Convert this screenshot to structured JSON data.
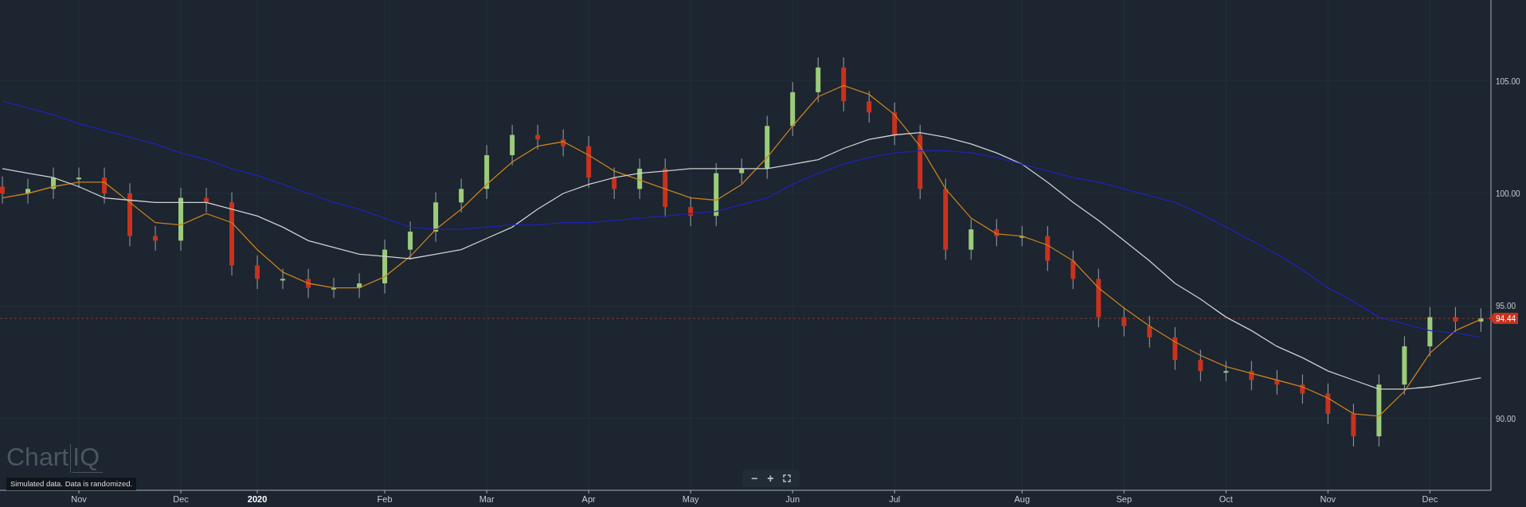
{
  "chart": {
    "chart_data": {
      "type": "candlestick",
      "categories": [
        null,
        null,
        null,
        "Nov",
        null,
        null,
        null,
        "Dec",
        null,
        null,
        "2020",
        null,
        null,
        null,
        null,
        "Feb",
        null,
        null,
        null,
        "Mar",
        null,
        null,
        null,
        "Apr",
        null,
        null,
        null,
        "May",
        null,
        null,
        null,
        "Jun",
        null,
        null,
        null,
        "Jul",
        null,
        null,
        null,
        null,
        "Aug",
        null,
        null,
        null,
        "Sep",
        null,
        null,
        null,
        "Oct",
        null,
        null,
        null,
        "Nov",
        null,
        null,
        null,
        "Dec",
        null,
        null
      ],
      "ohlc": [
        [
          100.3,
          100.75,
          99.55,
          100.0
        ],
        [
          100.0,
          100.65,
          99.55,
          100.2
        ],
        [
          100.2,
          101.15,
          99.75,
          100.7
        ],
        [
          100.7,
          101.15,
          100.25,
          100.7
        ],
        [
          100.7,
          101.15,
          99.55,
          100.0
        ],
        [
          100.0,
          100.45,
          97.65,
          98.1
        ],
        [
          98.1,
          98.55,
          97.45,
          97.9
        ],
        [
          97.9,
          100.25,
          97.45,
          99.8
        ],
        [
          99.8,
          100.25,
          99.15,
          99.6
        ],
        [
          99.6,
          100.05,
          96.35,
          96.8
        ],
        [
          96.8,
          97.25,
          95.75,
          96.2
        ],
        [
          96.2,
          96.65,
          95.75,
          96.2
        ],
        [
          96.2,
          96.65,
          95.35,
          95.8
        ],
        [
          95.8,
          96.25,
          95.35,
          95.8
        ],
        [
          95.8,
          96.45,
          95.35,
          96.0
        ],
        [
          96.0,
          97.95,
          95.55,
          97.5
        ],
        [
          97.5,
          98.75,
          97.05,
          98.3
        ],
        [
          98.3,
          100.05,
          97.85,
          99.6
        ],
        [
          99.6,
          100.65,
          99.15,
          100.2
        ],
        [
          100.2,
          102.15,
          99.75,
          101.7
        ],
        [
          101.7,
          103.05,
          101.25,
          102.6
        ],
        [
          102.6,
          103.05,
          101.95,
          102.4
        ],
        [
          102.4,
          102.85,
          101.65,
          102.1
        ],
        [
          102.1,
          102.55,
          100.25,
          100.7
        ],
        [
          100.7,
          101.15,
          99.75,
          100.2
        ],
        [
          100.2,
          101.55,
          99.75,
          101.1
        ],
        [
          101.1,
          101.55,
          98.95,
          99.4
        ],
        [
          99.4,
          99.85,
          98.55,
          99.0
        ],
        [
          99.0,
          101.35,
          98.55,
          100.9
        ],
        [
          100.9,
          101.55,
          100.45,
          101.1
        ],
        [
          101.1,
          103.45,
          100.65,
          103.0
        ],
        [
          103.0,
          104.95,
          102.55,
          104.5
        ],
        [
          104.5,
          106.05,
          104.05,
          105.6
        ],
        [
          105.6,
          106.05,
          103.65,
          104.1
        ],
        [
          104.1,
          104.55,
          103.15,
          103.6
        ],
        [
          103.6,
          104.05,
          102.15,
          102.6
        ],
        [
          102.6,
          103.05,
          99.75,
          100.2
        ],
        [
          100.2,
          100.65,
          97.05,
          97.5
        ],
        [
          97.5,
          98.85,
          97.05,
          98.4
        ],
        [
          98.4,
          98.85,
          97.65,
          98.1
        ],
        [
          98.1,
          98.55,
          97.65,
          98.1
        ],
        [
          98.1,
          98.55,
          96.55,
          97.0
        ],
        [
          97.0,
          97.45,
          95.75,
          96.2
        ],
        [
          96.2,
          96.65,
          94.05,
          94.5
        ],
        [
          94.5,
          94.95,
          93.65,
          94.1
        ],
        [
          94.1,
          94.55,
          93.15,
          93.6
        ],
        [
          93.6,
          94.05,
          92.15,
          92.6
        ],
        [
          92.6,
          93.05,
          91.65,
          92.1
        ],
        [
          92.1,
          92.55,
          91.65,
          92.1
        ],
        [
          92.1,
          92.55,
          91.25,
          91.7
        ],
        [
          91.7,
          92.15,
          91.05,
          91.5
        ],
        [
          91.5,
          91.95,
          90.65,
          91.1
        ],
        [
          91.1,
          91.55,
          89.75,
          90.2
        ],
        [
          90.2,
          90.65,
          88.75,
          89.2
        ],
        [
          89.2,
          91.95,
          88.75,
          91.5
        ],
        [
          91.5,
          93.65,
          91.05,
          93.2
        ],
        [
          93.2,
          94.95,
          92.75,
          94.5
        ],
        [
          94.5,
          94.95,
          93.85,
          94.3
        ],
        [
          94.3,
          94.89,
          93.85,
          94.44
        ]
      ],
      "series": [
        {
          "type": "line",
          "color": "#c8801e",
          "values": [
            99.8,
            100.0,
            100.3,
            100.5,
            100.5,
            99.6,
            98.7,
            98.6,
            99.1,
            98.7,
            97.5,
            96.5,
            96.0,
            95.8,
            95.8,
            96.3,
            97.2,
            98.4,
            99.3,
            100.4,
            101.4,
            102.1,
            102.3,
            101.7,
            101.0,
            100.6,
            100.2,
            99.8,
            99.7,
            100.4,
            101.6,
            103.0,
            104.3,
            104.8,
            104.4,
            103.5,
            102.1,
            100.2,
            98.9,
            98.2,
            98.1,
            97.7,
            97.0,
            95.8,
            94.9,
            94.1,
            93.4,
            92.8,
            92.3,
            92.0,
            91.7,
            91.4,
            90.9,
            90.2,
            90.1,
            91.2,
            92.9,
            93.9,
            94.4
          ]
        },
        {
          "type": "line",
          "color": "#d0d0d0",
          "values": [
            101.1,
            100.9,
            100.7,
            100.3,
            99.8,
            99.7,
            99.6,
            99.6,
            99.6,
            99.3,
            99.0,
            98.5,
            97.9,
            97.6,
            97.3,
            97.2,
            97.1,
            97.3,
            97.5,
            98.0,
            98.5,
            99.3,
            100.0,
            100.4,
            100.7,
            100.9,
            101.0,
            101.1,
            101.1,
            101.1,
            101.1,
            101.3,
            101.5,
            102.0,
            102.4,
            102.6,
            102.7,
            102.5,
            102.2,
            101.8,
            101.3,
            100.5,
            99.6,
            98.8,
            97.9,
            97.0,
            96.0,
            95.3,
            94.5,
            93.9,
            93.2,
            92.7,
            92.1,
            91.7,
            91.3,
            91.3,
            91.4,
            91.6,
            91.8
          ]
        },
        {
          "type": "line",
          "color": "#2222b4",
          "values": [
            104.1,
            103.8,
            103.5,
            103.1,
            102.8,
            102.5,
            102.2,
            101.8,
            101.5,
            101.1,
            100.8,
            100.4,
            100.0,
            99.6,
            99.3,
            98.9,
            98.5,
            98.4,
            98.4,
            98.5,
            98.6,
            98.6,
            98.7,
            98.7,
            98.8,
            98.9,
            99.0,
            99.1,
            99.2,
            99.5,
            99.8,
            100.4,
            100.9,
            101.3,
            101.6,
            101.8,
            101.9,
            101.9,
            101.8,
            101.6,
            101.3,
            101.0,
            100.7,
            100.5,
            100.2,
            99.9,
            99.6,
            99.1,
            98.5,
            97.9,
            97.3,
            96.6,
            95.8,
            95.2,
            94.5,
            94.2,
            93.9,
            93.8,
            93.6
          ]
        }
      ],
      "ylim": [
        86.8,
        108.6
      ],
      "yticks": [
        {
          "value": 90,
          "label": "90.00"
        },
        {
          "value": 95,
          "label": "95.00"
        },
        {
          "value": 100,
          "label": "100.00"
        },
        {
          "value": 105,
          "label": "105.00"
        }
      ],
      "grid": true,
      "ref_lines": [
        {
          "axis": "y",
          "value": 94.44,
          "label": "94.44"
        }
      ]
    }
  },
  "logo": {
    "text_1": "Chart",
    "text_2": "IQ"
  },
  "notice": "Simulated data.  Data is randomized.",
  "zoom_controls": {
    "zoom_out": "−",
    "zoom_in": "+"
  }
}
